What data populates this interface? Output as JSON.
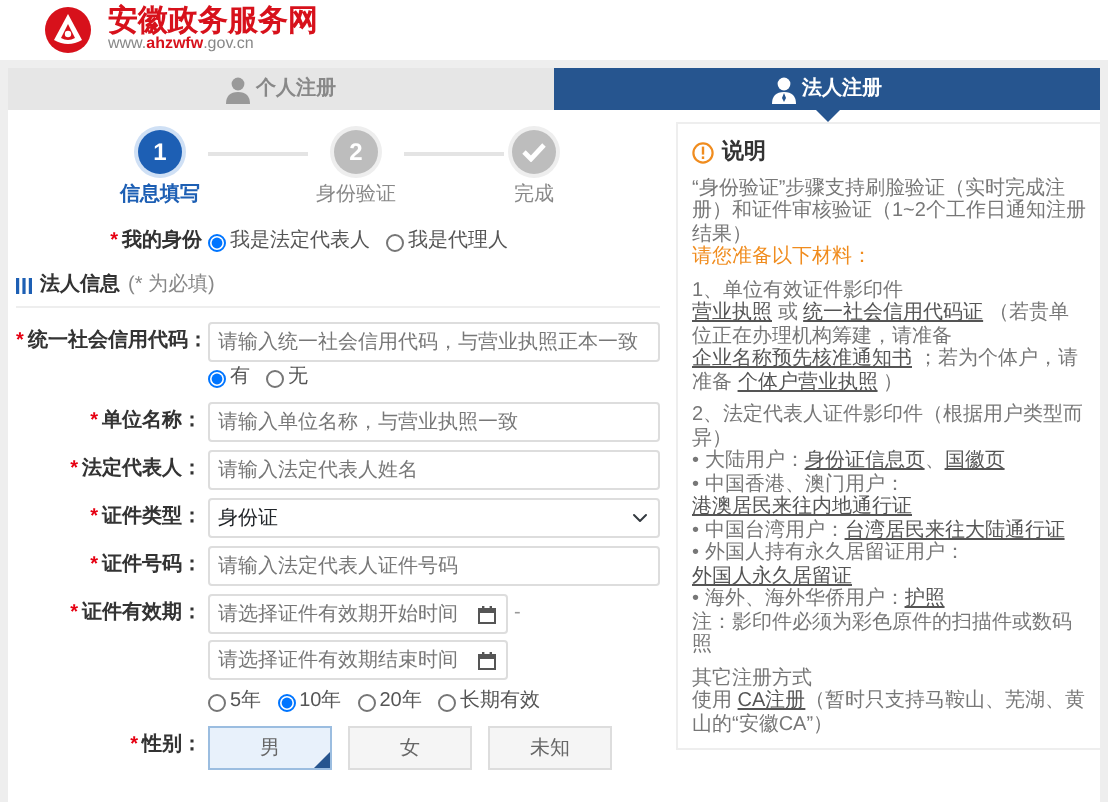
{
  "site": {
    "title": "安徽政务服务网",
    "url": "www.**ahzwfw**.gov.cn"
  },
  "tabs": [
    {
      "label": "个人注册",
      "selected": false
    },
    {
      "label": "法人注册",
      "selected": true
    }
  ],
  "steps": [
    {
      "kind": "number",
      "number": "1",
      "label": "信息填写",
      "selected": true
    },
    {
      "kind": "number",
      "number": "2",
      "label": "身份验证",
      "selected": false
    },
    {
      "kind": "check",
      "label": "完成",
      "selected": false
    }
  ],
  "identity": {
    "mark": "*",
    "label": "我的身份",
    "options": [
      {
        "label": "我是法定代表人",
        "selected": true
      },
      {
        "label": "我是代理人",
        "selected": false
      }
    ]
  },
  "section": {
    "title": "法人信息",
    "hint": "(* 为必填)"
  },
  "fields": [
    {
      "kind": "text",
      "mark": "*",
      "label": "统一社会信用代码：",
      "placeholder": "请输入统一社会信用代码，与营业执照正本一致",
      "options": [
        {
          "label": "有",
          "selected": true
        },
        {
          "label": "无",
          "selected": false
        }
      ]
    },
    {
      "kind": "text",
      "mark": "*",
      "label": "单位名称：",
      "placeholder": "请输入单位名称，与营业执照一致"
    },
    {
      "kind": "text",
      "mark": "*",
      "label": "法定代表人：",
      "placeholder": "请输入法定代表人姓名"
    },
    {
      "kind": "select",
      "mark": "*",
      "label": "证件类型：",
      "value": "身份证"
    },
    {
      "kind": "text",
      "mark": "*",
      "label": "证件号码：",
      "placeholder": "请输入法定代表人证件号码"
    },
    {
      "kind": "daterange",
      "mark": "*",
      "label": "证件有效期：",
      "start_placeholder": "请选择证件有效期开始时间",
      "separator": "-",
      "end_placeholder": "请选择证件有效期结束时间",
      "options": [
        {
          "label": "5年",
          "selected": false
        },
        {
          "label": "10年",
          "selected": true
        },
        {
          "label": "20年",
          "selected": false
        },
        {
          "label": "长期有效",
          "selected": false
        }
      ]
    }
  ],
  "gender": {
    "mark": "*",
    "label": "性别：",
    "options": [
      {
        "label": "男",
        "selected": true
      },
      {
        "label": "女",
        "selected": false
      },
      {
        "label": "未知",
        "selected": false
      }
    ]
  },
  "notes": {
    "title": "说明",
    "items": [
      {
        "kind": "text",
        "parts": [
          {
            "kind": "text",
            "text": "“身份验证”步骤支持刷脸验证（实时完成注册）和证件审核验证（1~2个工作日通知注册结果）"
          }
        ]
      },
      {
        "kind": "highlight",
        "parts": [
          {
            "kind": "text",
            "text": "请您准备以下材料："
          }
        ]
      },
      {
        "kind": "section",
        "parts": [
          {
            "kind": "text",
            "text": "1、单位有效证件影印件"
          }
        ]
      },
      {
        "kind": "text",
        "parts": [
          {
            "kind": "link",
            "text": "营业执照"
          },
          {
            "kind": "text",
            "text": " 或 "
          },
          {
            "kind": "link",
            "text": "统一社会信用代码证"
          },
          {
            "kind": "text",
            "text": " （若贵单位正在办理机构筹建，请准备 "
          },
          {
            "kind": "link",
            "text": "企业名称预先核准通知书"
          },
          {
            "kind": "text",
            "text": " ；若为个体户，请准备 "
          },
          {
            "kind": "link",
            "text": "个体户营业执照"
          },
          {
            "kind": "text",
            "text": " ）"
          }
        ]
      },
      {
        "kind": "section",
        "parts": [
          {
            "kind": "text",
            "text": "2、法定代表人证件影印件（根据用户类型而异）"
          }
        ]
      },
      {
        "kind": "text",
        "parts": [
          {
            "kind": "text",
            "text": "• 大陆用户："
          },
          {
            "kind": "link",
            "text": "身份证信息页"
          },
          {
            "kind": "text",
            "text": "、"
          },
          {
            "kind": "link",
            "text": "国徽页"
          }
        ]
      },
      {
        "kind": "text",
        "parts": [
          {
            "kind": "text",
            "text": "• 中国香港、澳门用户："
          },
          {
            "kind": "link",
            "text": "港澳居民来往内地通行证"
          }
        ]
      },
      {
        "kind": "text",
        "parts": [
          {
            "kind": "text",
            "text": "• 中国台湾用户："
          },
          {
            "kind": "link",
            "text": "台湾居民来往大陆通行证"
          }
        ]
      },
      {
        "kind": "text",
        "parts": [
          {
            "kind": "text",
            "text": "• 外国人持有永久居留证用户："
          },
          {
            "kind": "link",
            "text": "外国人永久居留证"
          }
        ]
      },
      {
        "kind": "text",
        "parts": [
          {
            "kind": "text",
            "text": "• 海外、海外华侨用户："
          },
          {
            "kind": "link",
            "text": "护照"
          }
        ]
      },
      {
        "kind": "text",
        "parts": [
          {
            "kind": "text",
            "text": "注：影印件必须为彩色原件的扫描件或数码照"
          }
        ]
      },
      {
        "kind": "section",
        "parts": [
          {
            "kind": "text",
            "text": "其它注册方式"
          }
        ]
      },
      {
        "kind": "text",
        "parts": [
          {
            "kind": "text",
            "text": "使用 "
          },
          {
            "kind": "link",
            "text": "CA注册"
          },
          {
            "kind": "text",
            "text": "（暂时只支持马鞍山、芜湖、黄山的“安徽CA”）"
          }
        ]
      }
    ]
  }
}
